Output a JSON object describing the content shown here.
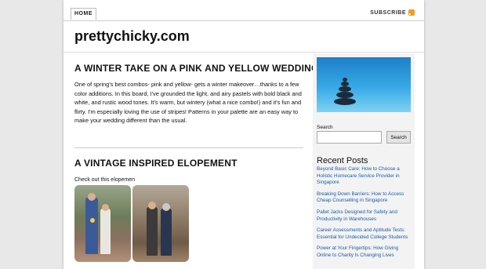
{
  "nav": {
    "home_label": "HOME",
    "subscribe_label": "SUBSCRIBE"
  },
  "site": {
    "title": "prettychicky.com"
  },
  "posts": [
    {
      "title": "A WINTER TAKE ON A PINK AND YELLOW WEDDING",
      "body": "One of spring's best combos- pink and yellow- gets a winter makeover…thanks to a few color additions. In this board, I've grounded the light, and airy pastels with bold black and white, and rustic wood tones. It's warm, but wintery (what a nice combo!) and it's fun and flirty. I'm especially loving the use of stripes! Patterns in your palette are an easy way to make your wedding different than the usual."
    },
    {
      "title": "A VINTAGE INSPIRED ELOPEMENT",
      "body": "Check out this elopemen"
    }
  ],
  "sidebar": {
    "search_label": "Search",
    "search_value": "",
    "search_button": "Search",
    "recent_title": "Recent Posts",
    "recent_posts": [
      "Beyond Basic Care: How to Choose a Holistic Homecare Service Provider in Singapore",
      "Breaking Down Barriers: How to Access Cheap Counselling in Singapore",
      "Pallet Jacks Designed for Safety and Productivity in Warehouses",
      "Career Assessments and Aptitude Tests: Essential for Undecided College Students",
      "Power at Your Fingertips: How Giving Online to Charity Is Changing Lives"
    ]
  },
  "colors": {
    "link": "#1a5ca6",
    "rss": "#f29b21"
  }
}
